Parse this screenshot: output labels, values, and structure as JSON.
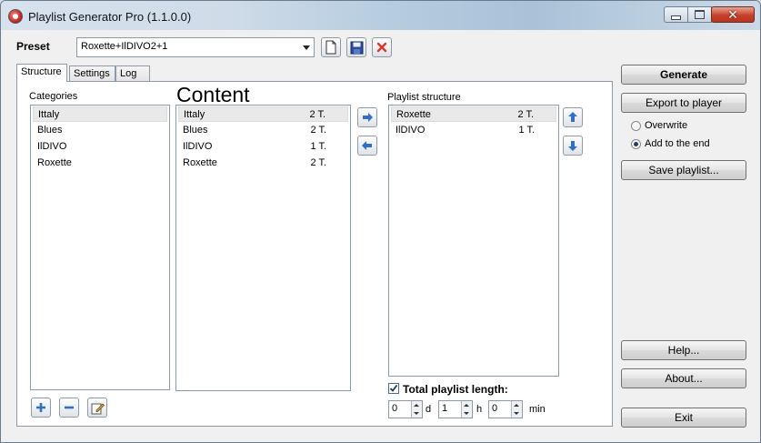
{
  "window": {
    "title": "Playlist Generator Pro (1.1.0.0)"
  },
  "preset": {
    "label": "Preset",
    "value": "Roxette+IlDIVO2+1"
  },
  "tabs": [
    {
      "label": "Structure"
    },
    {
      "label": "Settings"
    },
    {
      "label": "Log"
    }
  ],
  "categories": {
    "label": "Categories",
    "items": [
      "Ittaly",
      "Blues",
      "IlDIVO",
      "Roxette"
    ]
  },
  "content": {
    "heading": "Content",
    "items": [
      {
        "name": "Ittaly",
        "count": "2 T."
      },
      {
        "name": "Blues",
        "count": "2 T."
      },
      {
        "name": "IlDIVO",
        "count": "1 T."
      },
      {
        "name": "Roxette",
        "count": "2 T."
      }
    ]
  },
  "playlist": {
    "label": "Playlist structure",
    "items": [
      {
        "name": "Roxette",
        "count": "2 T."
      },
      {
        "name": "IlDIVO",
        "count": "1 T."
      }
    ]
  },
  "length": {
    "label": "Total playlist length:",
    "checked": true,
    "days": "0",
    "days_unit": "d",
    "hours": "1",
    "hours_unit": "h",
    "minutes": "0",
    "minutes_unit": "min"
  },
  "actions": {
    "generate": "Generate",
    "export": "Export to player",
    "overwrite": "Overwrite",
    "add_to_end": "Add to the end",
    "save": "Save playlist...",
    "help": "Help...",
    "about": "About...",
    "exit": "Exit"
  },
  "colors": {
    "arrow_blue": "#2f6fc4",
    "delete_red": "#d33a2c"
  }
}
